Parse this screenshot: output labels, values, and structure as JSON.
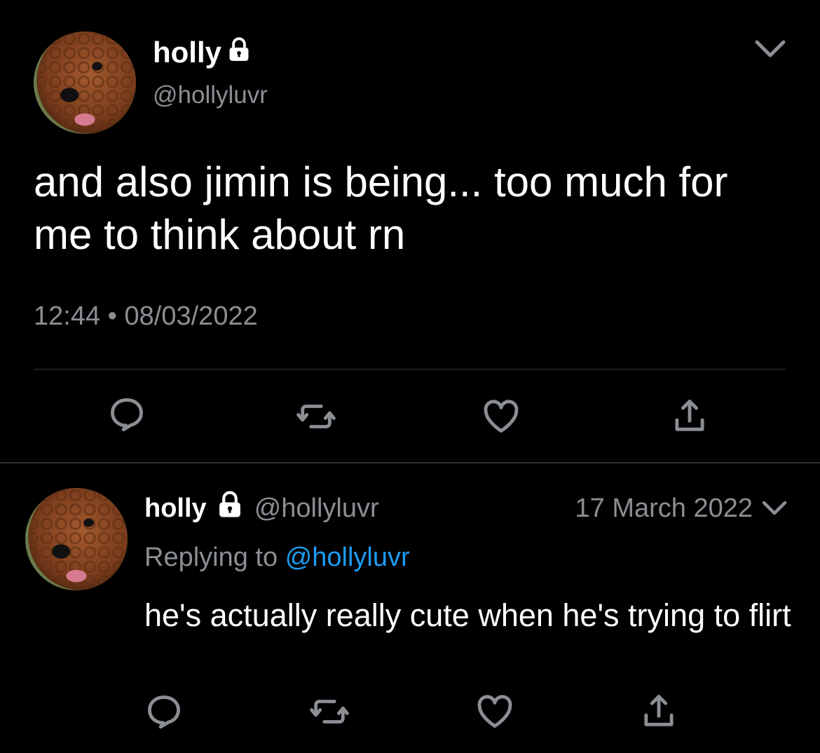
{
  "main_tweet": {
    "display_name": "holly",
    "handle": "@hollyluvr",
    "text": "and also jimin is being... too much for me to think about rn",
    "time": "12:44",
    "separator": "•",
    "date": "08/03/2022",
    "icons": [
      "lock-icon",
      "chevron-down-icon",
      "reply-icon",
      "retweet-icon",
      "like-icon",
      "share-icon"
    ]
  },
  "reply_tweet": {
    "display_name": "holly",
    "handle": "@hollyluvr",
    "date": "17 March 2022",
    "replying_prefix": "Replying to",
    "replying_mention": "@hollyluvr",
    "text": "he's actually really cute when he's trying to flirt",
    "icons": [
      "lock-icon",
      "chevron-down-icon",
      "reply-icon",
      "retweet-icon",
      "like-icon",
      "share-icon"
    ]
  },
  "colors": {
    "background": "#000000",
    "text": "#ffffff",
    "secondary": "#8b8f94",
    "link": "#1d9bf0",
    "divider": "#2f3336",
    "avatar_fur": "#8b4a26"
  }
}
